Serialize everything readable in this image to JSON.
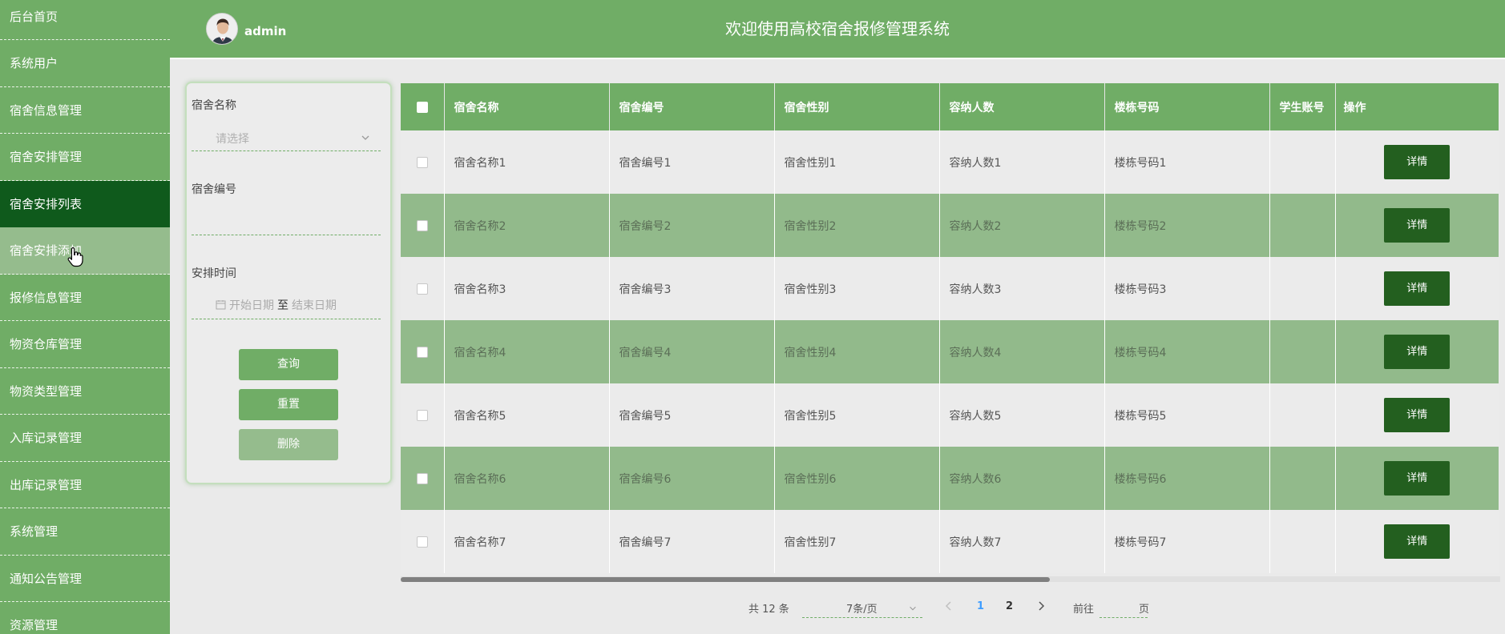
{
  "sidebar": {
    "items": [
      {
        "label": "后台首页"
      },
      {
        "label": "系统用户"
      },
      {
        "label": "宿舍信息管理"
      },
      {
        "label": "宿舍安排管理"
      },
      {
        "label": "宿舍安排列表"
      },
      {
        "label": "宿舍安排添加"
      },
      {
        "label": "报修信息管理"
      },
      {
        "label": "物资仓库管理"
      },
      {
        "label": "物资类型管理"
      },
      {
        "label": "入库记录管理"
      },
      {
        "label": "出库记录管理"
      },
      {
        "label": "系统管理"
      },
      {
        "label": "通知公告管理"
      },
      {
        "label": "资源管理"
      }
    ],
    "active_index": 4,
    "hover_index": 5
  },
  "header": {
    "username": "admin",
    "title": "欢迎使用高校宿舍报修管理系统"
  },
  "filter": {
    "name_label": "宿舍名称",
    "name_placeholder": "请选择",
    "code_label": "宿舍编号",
    "code_value": "",
    "time_label": "安排时间",
    "start_placeholder": "开始日期",
    "range_sep": "至",
    "end_placeholder": "结束日期",
    "query_label": "查询",
    "reset_label": "重置",
    "delete_label": "删除"
  },
  "table": {
    "columns": [
      "宿舍名称",
      "宿舍编号",
      "宿舍性别",
      "容纳人数",
      "楼栋号码",
      "学生账号",
      "操作"
    ],
    "rows": [
      [
        "宿舍名称1",
        "宿舍编号1",
        "宿舍性别1",
        "容纳人数1",
        "楼栋号码1",
        ""
      ],
      [
        "宿舍名称2",
        "宿舍编号2",
        "宿舍性别2",
        "容纳人数2",
        "楼栋号码2",
        ""
      ],
      [
        "宿舍名称3",
        "宿舍编号3",
        "宿舍性别3",
        "容纳人数3",
        "楼栋号码3",
        ""
      ],
      [
        "宿舍名称4",
        "宿舍编号4",
        "宿舍性别4",
        "容纳人数4",
        "楼栋号码4",
        ""
      ],
      [
        "宿舍名称5",
        "宿舍编号5",
        "宿舍性别5",
        "容纳人数5",
        "楼栋号码5",
        ""
      ],
      [
        "宿舍名称6",
        "宿舍编号6",
        "宿舍性别6",
        "容纳人数6",
        "楼栋号码6",
        ""
      ],
      [
        "宿舍名称7",
        "宿舍编号7",
        "宿舍性别7",
        "容纳人数7",
        "楼栋号码7",
        ""
      ]
    ],
    "detail_label": "详情"
  },
  "pagination": {
    "total": "共 12 条",
    "page_size": "7条/页",
    "pages": [
      "1",
      "2"
    ],
    "current_page": "1",
    "goto_label": "前往",
    "goto_value": "",
    "unit": "页"
  },
  "colors": {
    "primary": "#70ad66",
    "active_nav": "#0f5a1c",
    "button_dark": "#235f1f",
    "row_alt": "#92ba8b",
    "page_active": "#409eff"
  }
}
